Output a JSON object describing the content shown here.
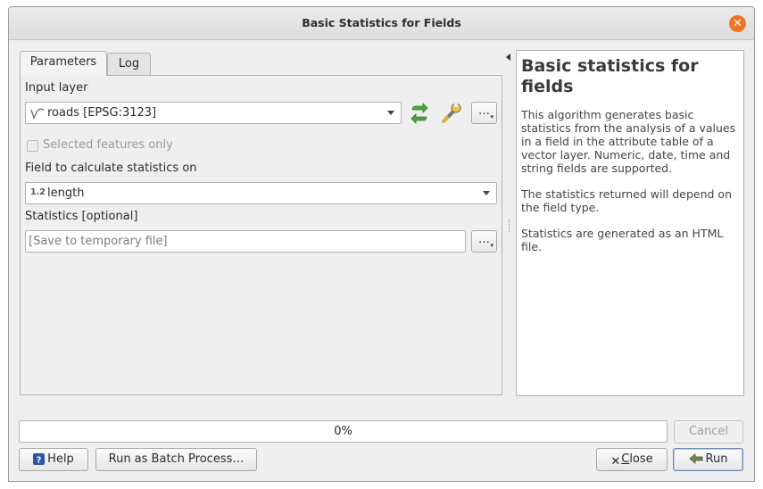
{
  "window": {
    "title": "Basic Statistics for Fields"
  },
  "tabs": [
    {
      "label": "Parameters"
    },
    {
      "label": "Log"
    }
  ],
  "form": {
    "input_layer_label": "Input layer",
    "input_layer_value": "roads [EPSG:3123]",
    "selected_only_label": "Selected features only",
    "field_label": "Field to calculate statistics on",
    "field_type_glyph": "1.2",
    "field_value": "length",
    "statistics_label": "Statistics [optional]",
    "statistics_placeholder": "[Save to temporary file]",
    "ellipsis": "…"
  },
  "help": {
    "title": "Basic statistics for fields",
    "p1": "This algorithm generates basic statistics from the analysis of a values in a field in the attribute table of a vector layer. Numeric, date, time and string fields are supported.",
    "p2": "The statistics returned will depend on the field type.",
    "p3": "Statistics are generated as an HTML file."
  },
  "progress": {
    "text": "0%",
    "value": 0
  },
  "buttons": {
    "cancel": "Cancel",
    "help": "Help",
    "batch": "Run as Batch Process…",
    "close_first": "C",
    "close_rest": "lose",
    "run": "Run"
  },
  "colors": {
    "accent": "#f07523",
    "default_border": "#6a86b0"
  }
}
